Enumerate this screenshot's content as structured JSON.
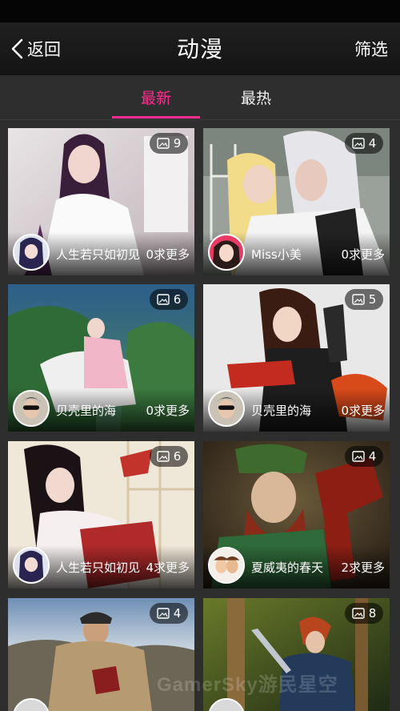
{
  "header": {
    "back_label": "返回",
    "title": "动漫",
    "filter_label": "筛选"
  },
  "tabs": [
    {
      "label": "最新",
      "active": true
    },
    {
      "label": "最热",
      "active": false
    }
  ],
  "cards": [
    {
      "count": "9",
      "author": "人生若只如初见",
      "requests": "0求更多",
      "avatar": "anime-girl-avatar"
    },
    {
      "count": "4",
      "author": "Miss小美",
      "requests": "0求更多",
      "avatar": "woman-portrait-avatar"
    },
    {
      "count": "6",
      "author": "贝壳里的海",
      "requests": "0求更多",
      "avatar": "man-sunglasses-avatar"
    },
    {
      "count": "5",
      "author": "贝壳里的海",
      "requests": "0求更多",
      "avatar": "man-sunglasses-avatar"
    },
    {
      "count": "6",
      "author": "人生若只如初见",
      "requests": "4求更多",
      "avatar": "anime-girl-avatar"
    },
    {
      "count": "4",
      "author": "夏威夷的春天",
      "requests": "2求更多",
      "avatar": "cartoon-avatar"
    },
    {
      "count": "4",
      "author": "",
      "requests": "",
      "avatar": "partial-avatar"
    },
    {
      "count": "8",
      "author": "",
      "requests": "",
      "avatar": "partial-avatar"
    }
  ],
  "watermark": "GamerSky游民星空",
  "colors": {
    "accent": "#ff2d8f",
    "background": "#2e2e2e",
    "header": "#1a1a1a"
  }
}
